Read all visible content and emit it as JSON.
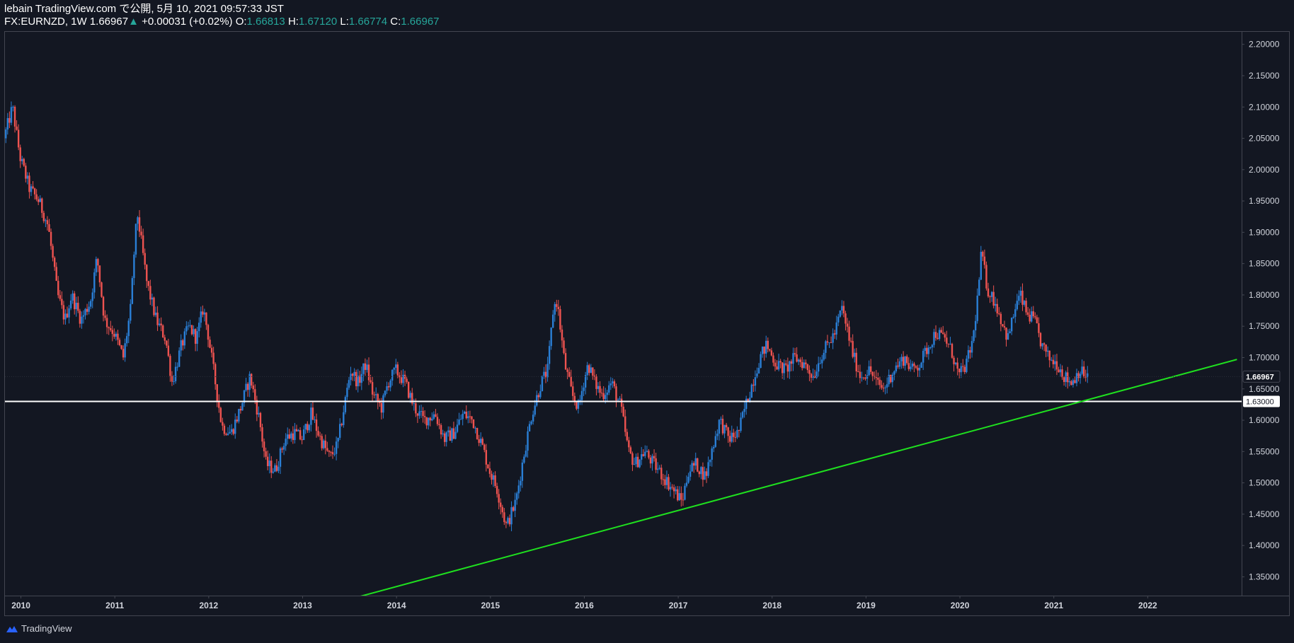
{
  "header": {
    "author_line": "lebain TradingView.com で公開, 5月 10, 2021 09:57:33 JST",
    "symbol_line": "FX:EURNZD, 1W 1.66967",
    "change_arrow": "▲",
    "change_text": "+0.00031 (+0.02%)",
    "o_label": "O:",
    "o_value": "1.66813",
    "h_label": "H:",
    "h_value": "1.67120",
    "l_label": "L:",
    "l_value": "1.66774",
    "c_label": "C:",
    "c_value": "1.66967"
  },
  "footer": {
    "brand": "TradingView",
    "brand_icon": "tradingview-cloud-icon"
  },
  "colors": {
    "background": "#131722",
    "up": "#2a7fd6",
    "down": "#ef5350",
    "trendline": "#1fe01f",
    "horizontal_line": "#ffffff",
    "grid": "#1e2230"
  },
  "chart_data": {
    "type": "candlestick",
    "symbol": "FX:EURNZD",
    "interval": "1W",
    "x_range": [
      2009.83,
      2023.0
    ],
    "y_range": [
      1.32,
      2.22
    ],
    "x_ticks": [
      "2010",
      "2011",
      "2012",
      "2013",
      "2014",
      "2015",
      "2016",
      "2017",
      "2018",
      "2019",
      "2020",
      "2021",
      "2022"
    ],
    "y_ticks": [
      "2.20000",
      "2.15000",
      "2.10000",
      "2.05000",
      "2.00000",
      "1.95000",
      "1.90000",
      "1.85000",
      "1.80000",
      "1.75000",
      "1.70000",
      "1.65000",
      "1.60000",
      "1.55000",
      "1.50000",
      "1.45000",
      "1.40000",
      "1.35000"
    ],
    "last_price_label": "1.66967",
    "last_price": 1.66967,
    "horizontal_line_label": "1.63000",
    "horizontal_line": 1.63,
    "trendline": {
      "points": [
        [
          2013.52,
          1.315
        ],
        [
          2022.95,
          1.697
        ]
      ]
    },
    "price_path": [
      [
        2009.83,
        2.05
      ],
      [
        2009.92,
        2.1
      ],
      [
        2010.0,
        2.02
      ],
      [
        2010.1,
        1.97
      ],
      [
        2010.2,
        1.95
      ],
      [
        2010.3,
        1.91
      ],
      [
        2010.4,
        1.8
      ],
      [
        2010.48,
        1.76
      ],
      [
        2010.55,
        1.8
      ],
      [
        2010.65,
        1.76
      ],
      [
        2010.75,
        1.79
      ],
      [
        2010.82,
        1.86
      ],
      [
        2010.9,
        1.76
      ],
      [
        2011.0,
        1.74
      ],
      [
        2011.1,
        1.7
      ],
      [
        2011.18,
        1.78
      ],
      [
        2011.22,
        1.88
      ],
      [
        2011.25,
        1.93
      ],
      [
        2011.35,
        1.82
      ],
      [
        2011.45,
        1.76
      ],
      [
        2011.55,
        1.73
      ],
      [
        2011.62,
        1.66
      ],
      [
        2011.72,
        1.72
      ],
      [
        2011.8,
        1.75
      ],
      [
        2011.88,
        1.73
      ],
      [
        2011.95,
        1.78
      ],
      [
        2012.0,
        1.74
      ],
      [
        2012.08,
        1.66
      ],
      [
        2012.15,
        1.59
      ],
      [
        2012.25,
        1.58
      ],
      [
        2012.35,
        1.62
      ],
      [
        2012.45,
        1.67
      ],
      [
        2012.55,
        1.6
      ],
      [
        2012.62,
        1.53
      ],
      [
        2012.72,
        1.52
      ],
      [
        2012.82,
        1.57
      ],
      [
        2012.92,
        1.58
      ],
      [
        2013.0,
        1.57
      ],
      [
        2013.1,
        1.61
      ],
      [
        2013.2,
        1.57
      ],
      [
        2013.3,
        1.54
      ],
      [
        2013.38,
        1.56
      ],
      [
        2013.45,
        1.62
      ],
      [
        2013.52,
        1.68
      ],
      [
        2013.6,
        1.66
      ],
      [
        2013.68,
        1.69
      ],
      [
        2013.76,
        1.64
      ],
      [
        2013.85,
        1.62
      ],
      [
        2013.92,
        1.66
      ],
      [
        2014.0,
        1.68
      ],
      [
        2014.1,
        1.66
      ],
      [
        2014.2,
        1.62
      ],
      [
        2014.3,
        1.6
      ],
      [
        2014.42,
        1.61
      ],
      [
        2014.52,
        1.57
      ],
      [
        2014.62,
        1.58
      ],
      [
        2014.72,
        1.61
      ],
      [
        2014.82,
        1.6
      ],
      [
        2014.92,
        1.56
      ],
      [
        2015.0,
        1.52
      ],
      [
        2015.08,
        1.49
      ],
      [
        2015.18,
        1.43
      ],
      [
        2015.28,
        1.47
      ],
      [
        2015.36,
        1.54
      ],
      [
        2015.45,
        1.61
      ],
      [
        2015.55,
        1.66
      ],
      [
        2015.62,
        1.68
      ],
      [
        2015.68,
        1.78
      ],
      [
        2015.72,
        1.79
      ],
      [
        2015.8,
        1.69
      ],
      [
        2015.88,
        1.64
      ],
      [
        2015.95,
        1.62
      ],
      [
        2016.0,
        1.66
      ],
      [
        2016.05,
        1.69
      ],
      [
        2016.12,
        1.66
      ],
      [
        2016.2,
        1.64
      ],
      [
        2016.3,
        1.66
      ],
      [
        2016.4,
        1.62
      ],
      [
        2016.48,
        1.55
      ],
      [
        2016.55,
        1.53
      ],
      [
        2016.65,
        1.55
      ],
      [
        2016.75,
        1.53
      ],
      [
        2016.85,
        1.51
      ],
      [
        2016.95,
        1.49
      ],
      [
        2017.05,
        1.47
      ],
      [
        2017.12,
        1.52
      ],
      [
        2017.2,
        1.53
      ],
      [
        2017.3,
        1.51
      ],
      [
        2017.38,
        1.56
      ],
      [
        2017.45,
        1.6
      ],
      [
        2017.55,
        1.57
      ],
      [
        2017.65,
        1.58
      ],
      [
        2017.72,
        1.62
      ],
      [
        2017.8,
        1.66
      ],
      [
        2017.88,
        1.7
      ],
      [
        2017.95,
        1.72
      ],
      [
        2018.05,
        1.69
      ],
      [
        2018.15,
        1.68
      ],
      [
        2018.25,
        1.7
      ],
      [
        2018.35,
        1.69
      ],
      [
        2018.45,
        1.67
      ],
      [
        2018.52,
        1.7
      ],
      [
        2018.6,
        1.72
      ],
      [
        2018.68,
        1.74
      ],
      [
        2018.75,
        1.78
      ],
      [
        2018.8,
        1.75
      ],
      [
        2018.88,
        1.7
      ],
      [
        2018.95,
        1.67
      ],
      [
        2019.05,
        1.68
      ],
      [
        2019.12,
        1.66
      ],
      [
        2019.2,
        1.65
      ],
      [
        2019.3,
        1.68
      ],
      [
        2019.42,
        1.7
      ],
      [
        2019.5,
        1.68
      ],
      [
        2019.58,
        1.69
      ],
      [
        2019.68,
        1.72
      ],
      [
        2019.75,
        1.74
      ],
      [
        2019.85,
        1.73
      ],
      [
        2019.92,
        1.71
      ],
      [
        2020.0,
        1.67
      ],
      [
        2020.08,
        1.69
      ],
      [
        2020.15,
        1.73
      ],
      [
        2020.2,
        1.8
      ],
      [
        2020.24,
        1.87
      ],
      [
        2020.3,
        1.81
      ],
      [
        2020.38,
        1.79
      ],
      [
        2020.45,
        1.76
      ],
      [
        2020.52,
        1.73
      ],
      [
        2020.6,
        1.78
      ],
      [
        2020.65,
        1.8
      ],
      [
        2020.72,
        1.77
      ],
      [
        2020.8,
        1.76
      ],
      [
        2020.88,
        1.72
      ],
      [
        2020.95,
        1.7
      ],
      [
        2021.05,
        1.69
      ],
      [
        2021.12,
        1.67
      ],
      [
        2021.2,
        1.66
      ],
      [
        2021.28,
        1.68
      ],
      [
        2021.36,
        1.67
      ]
    ]
  }
}
